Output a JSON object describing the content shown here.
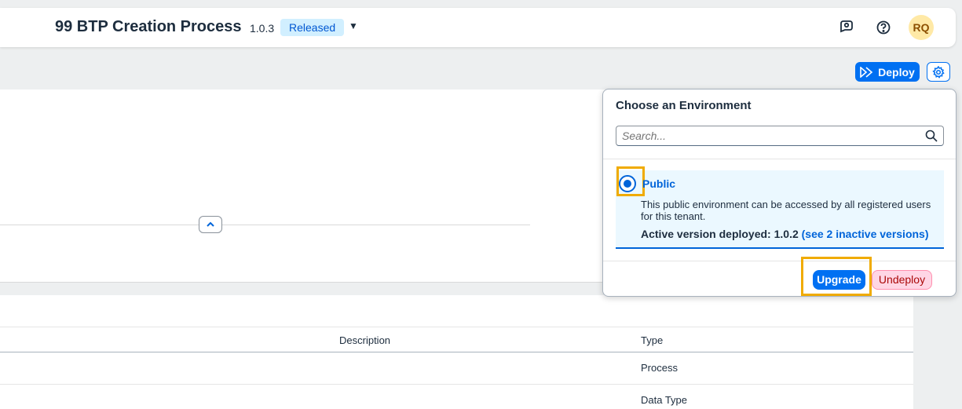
{
  "header": {
    "title": "99 BTP Creation Process",
    "version": "1.0.3",
    "status": "Released",
    "dropdown_glyph": "▼",
    "avatar_initials": "RQ",
    "icons": [
      "feedback-icon",
      "help-icon"
    ]
  },
  "toolbar": {
    "deploy_label": "Deploy",
    "settings_icon": "gear-icon"
  },
  "table": {
    "columns": [
      "Description",
      "Type"
    ],
    "rows": [
      {
        "description": "",
        "type": "Process"
      },
      {
        "description": "",
        "type": "Data Type"
      }
    ]
  },
  "popover": {
    "title": "Choose an Environment",
    "search_placeholder": "Search...",
    "environment": {
      "name": "Public",
      "description": "This public environment can be accessed by all registered users for this tenant.",
      "active_label": "Active version deployed: 1.0.2",
      "inactive_link": "(see 2 inactive versions)",
      "selected": true
    },
    "upgrade_label": "Upgrade",
    "undeploy_label": "Undeploy"
  },
  "colors": {
    "accent": "#0070f2",
    "highlight": "#f0ab00",
    "released_badge": "#d1efff",
    "undeploy_bg": "#ffd6e5"
  }
}
